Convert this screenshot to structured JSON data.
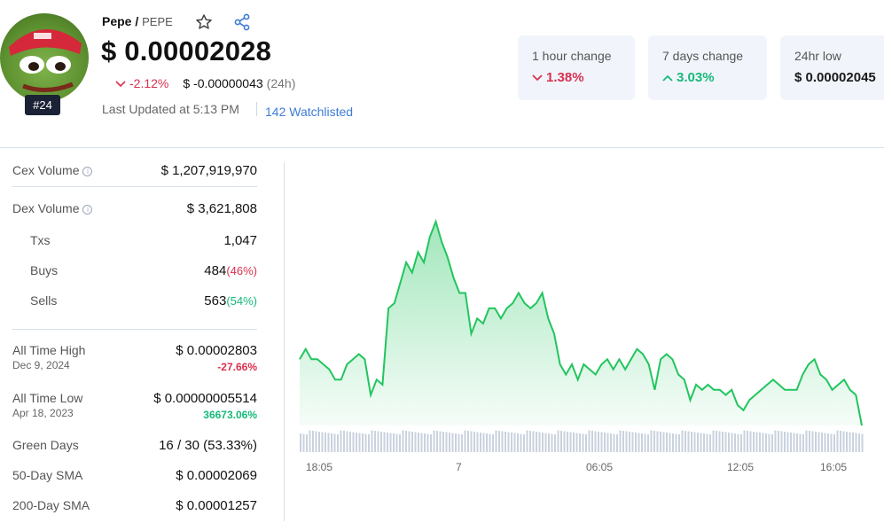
{
  "coin": {
    "name": "Pepe /",
    "symbol": "PEPE",
    "rank": "#24",
    "price": "$ 0.00002028",
    "change_24h_pct": "-2.12%",
    "change_24h_abs": "$ -0.00000043",
    "change_period": "(24h)",
    "last_updated": "Last Updated at 5:13 PM",
    "watchlisted": "142 Watchlisted"
  },
  "cards": [
    {
      "label": "1 hour change",
      "value": "1.38%",
      "direction": "down"
    },
    {
      "label": "7 days change",
      "value": "3.03%",
      "direction": "up"
    },
    {
      "label": "24hr low",
      "value": "$ 0.00002045",
      "direction": "none"
    }
  ],
  "stats": {
    "cex_volume": {
      "label": "Cex Volume",
      "value": "$ 1,207,919,970"
    },
    "dex_volume": {
      "label": "Dex Volume",
      "value": "$ 3,621,808"
    },
    "txs": {
      "label": "Txs",
      "value": "1,047"
    },
    "buys": {
      "label": "Buys",
      "value": "484",
      "pct": "(46%)"
    },
    "sells": {
      "label": "Sells",
      "value": "563",
      "pct": "(54%)"
    },
    "ath": {
      "label": "All Time High",
      "date": "Dec 9, 2024",
      "value": "$ 0.00002803",
      "pct": "-27.66%"
    },
    "atl": {
      "label": "All Time Low",
      "date": "Apr 18, 2023",
      "value": "$ 0.00000005514",
      "pct": "36673.06%"
    },
    "green_days": {
      "label": "Green Days",
      "value": "16 / 30 (53.33%)"
    },
    "sma50": {
      "label": "50-Day SMA",
      "value": "$ 0.00002069"
    },
    "sma200": {
      "label": "200-Day SMA",
      "value": "$ 0.00001257"
    }
  },
  "colors": {
    "red": "#d9304f",
    "green": "#16b979",
    "line": "#22c55e",
    "link": "#3e7bd6"
  },
  "chart_data": {
    "type": "area",
    "x_ticks": [
      "18:05",
      "7",
      "06:05",
      "12:05",
      "16:05"
    ],
    "values": [
      2.13e-05,
      2.15e-05,
      2.13e-05,
      2.13e-05,
      2.12e-05,
      2.11e-05,
      2.09e-05,
      2.09e-05,
      2.12e-05,
      2.13e-05,
      2.14e-05,
      2.13e-05,
      2.06e-05,
      2.09e-05,
      2.08e-05,
      2.23e-05,
      2.24e-05,
      2.28e-05,
      2.32e-05,
      2.3e-05,
      2.34e-05,
      2.32e-05,
      2.37e-05,
      2.4e-05,
      2.36e-05,
      2.33e-05,
      2.29e-05,
      2.26e-05,
      2.26e-05,
      2.18e-05,
      2.21e-05,
      2.2e-05,
      2.23e-05,
      2.23e-05,
      2.21e-05,
      2.23e-05,
      2.24e-05,
      2.26e-05,
      2.24e-05,
      2.23e-05,
      2.24e-05,
      2.26e-05,
      2.21e-05,
      2.18e-05,
      2.12e-05,
      2.1e-05,
      2.12e-05,
      2.09e-05,
      2.12e-05,
      2.11e-05,
      2.1e-05,
      2.12e-05,
      2.13e-05,
      2.11e-05,
      2.13e-05,
      2.11e-05,
      2.13e-05,
      2.15e-05,
      2.14e-05,
      2.12e-05,
      2.07e-05,
      2.13e-05,
      2.14e-05,
      2.13e-05,
      2.1e-05,
      2.09e-05,
      2.05e-05,
      2.08e-05,
      2.07e-05,
      2.08e-05,
      2.07e-05,
      2.07e-05,
      2.06e-05,
      2.07e-05,
      2.04e-05,
      2.03e-05,
      2.05e-05,
      2.06e-05,
      2.07e-05,
      2.08e-05,
      2.09e-05,
      2.08e-05,
      2.07e-05,
      2.07e-05,
      2.07e-05,
      2.1e-05,
      2.12e-05,
      2.13e-05,
      2.1e-05,
      2.09e-05,
      2.07e-05,
      2.08e-05,
      2.09e-05,
      2.07e-05,
      2.06e-05,
      2e-05
    ],
    "volume": true
  }
}
